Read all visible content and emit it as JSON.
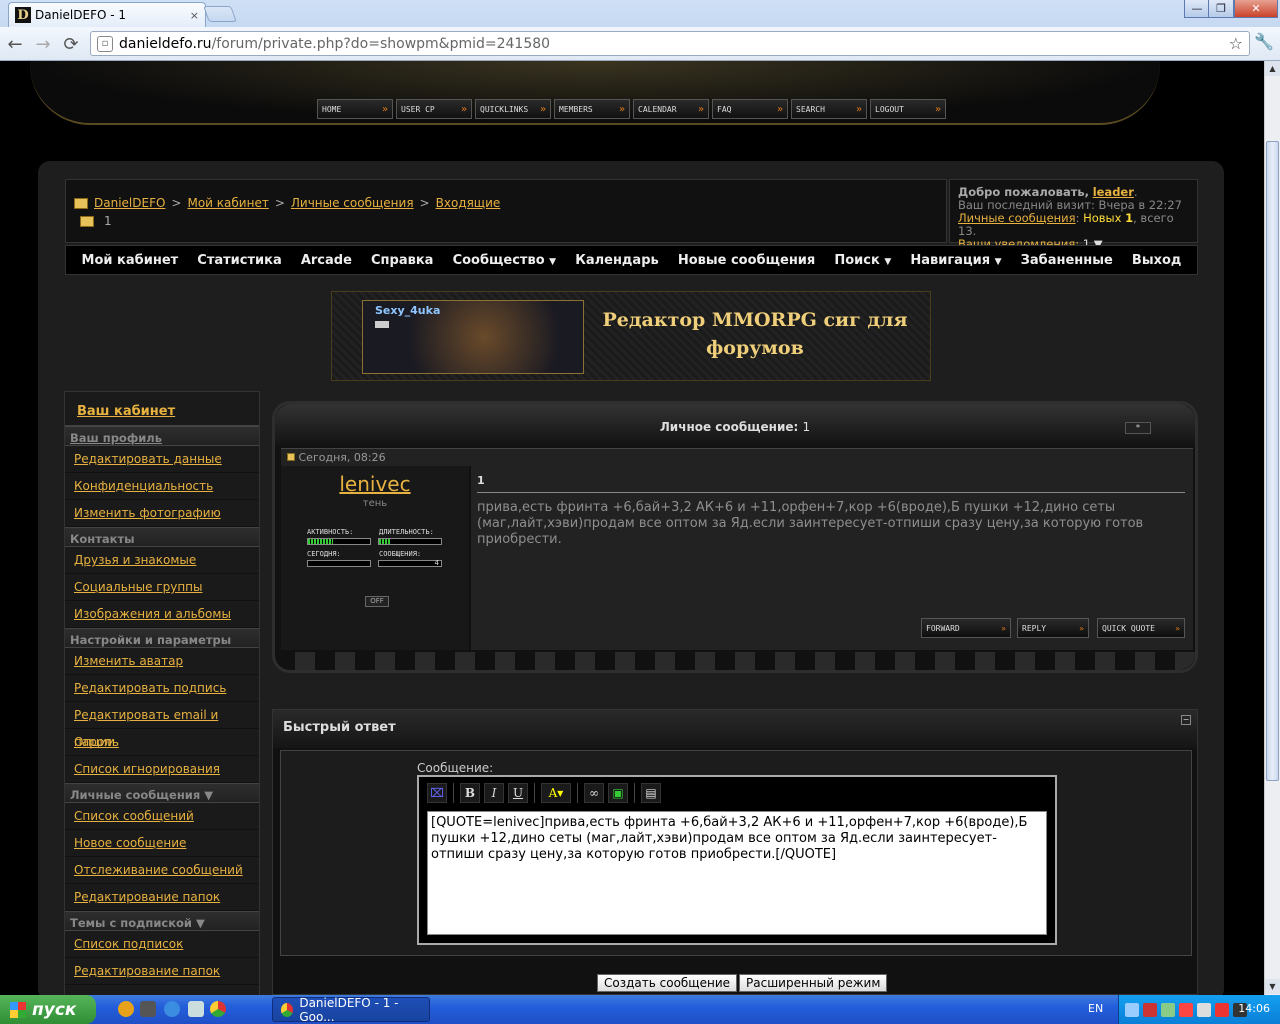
{
  "browser": {
    "tab_title": "DanielDEFO - 1",
    "tab_close": "×",
    "url_host": "danieldefo.ru",
    "url_path": "/forum/private.php?do=showpm&pmid=241580",
    "win_min": "—",
    "win_max": "❐",
    "win_close": "✕"
  },
  "topnav": [
    {
      "label": "HOME"
    },
    {
      "label": "USER CP"
    },
    {
      "label": "QUICKLINKS"
    },
    {
      "label": "MEMBERS"
    },
    {
      "label": "CALENDAR"
    },
    {
      "label": "FAQ"
    },
    {
      "label": "SEARCH"
    },
    {
      "label": "LOGOUT"
    }
  ],
  "breadcrumb": {
    "items": [
      "DanielDEFO",
      "Мой кабинет",
      "Личные сообщения",
      "Входящие"
    ],
    "sep": ">",
    "current": "1"
  },
  "welcome": {
    "greeting": "Добро пожаловать,",
    "username": "leader",
    "last_visit": "Ваш последний визит: Вчера в 22:27",
    "pm_link": "Личные сообщения",
    "pm_new_label": "Новых",
    "pm_new": "1",
    "pm_total": ", всего 13.",
    "notif_link": "Ваши уведомления:",
    "notif_count": "1"
  },
  "menu": {
    "items": [
      "Мой кабинет",
      "Статистика",
      "Arcade",
      "Справка",
      "Сообщество",
      "Календарь",
      "Новые сообщения",
      "Поиск",
      "Навигация",
      "Забаненные",
      "Выход"
    ],
    "dropdown_icon": "▼"
  },
  "banner": {
    "name": "Sexy_4uka",
    "title": "Редактор MMORPG сиг для форумов"
  },
  "sidebar": {
    "head": "Ваш кабинет",
    "sections": [
      {
        "title": "Ваш профиль",
        "items": [
          "Редактировать данные",
          "Конфиденциальность",
          "Изменить фотографию"
        ]
      },
      {
        "title": "Контакты",
        "items": [
          "Друзья и знакомые",
          "Социальные группы",
          "Изображения и альбомы"
        ]
      },
      {
        "title": "Настройки и параметры",
        "items": [
          "Изменить аватар",
          "Редактировать подпись",
          "Редактировать email и пароль",
          "Опции",
          "Список игнорирования"
        ]
      },
      {
        "title": "Личные сообщения ▼",
        "items": [
          "Список сообщений",
          "Новое сообщение",
          "Отслеживание сообщений",
          "Редактирование папок"
        ]
      },
      {
        "title": "Темы с подпиской ▼",
        "items": [
          "Список подписок",
          "Редактирование папок"
        ]
      }
    ]
  },
  "pm": {
    "header_label": "Личное сообщение:",
    "header_value": "1",
    "collapse": "*",
    "date": "Сегодня, 08:26",
    "user": "lenivec",
    "user_title": "тень",
    "activity": "АКТИВНОСТЬ:",
    "duration": "ДЛИТЕЛЬНОСТЬ:",
    "today": "СЕГОДНЯ:",
    "posts": "СООБЩЕНИЯ:",
    "posts_count": "4",
    "activity_level": 0.4,
    "duration_level": 0.18,
    "status": "OFF",
    "title": "1",
    "message": "прива,есть фринта +6,бай+3,2 АК+6 и +11,орфен+7,кор +6(вроде),Б пушки +12,дино сеты (маг,лайт,хэви)продам все оптом за Яд.если заинтересует-отпиши сразу цену,за которую готов приобрести.",
    "btn_forward": "FORWARD",
    "btn_reply": "REPLY",
    "btn_quote": "QUICK QUOTE"
  },
  "quickreply": {
    "title": "Быстрый ответ",
    "label": "Сообщение:",
    "text": "[QUOTE=lenivec]прива,есть фринта +6,бай+3,2 АК+6 и +11,орфен+7,кор +6(вроде),Б пушки +12,дино сеты (маг,лайт,хэви)продам все оптом за Яд.если заинтересует-отпиши сразу цену,за которую готов приобрести.[/QUOTE]",
    "submit": "Создать сообщение",
    "advanced": "Расширенный режим"
  },
  "taskbar": {
    "start": "пуск",
    "task": "DanielDEFO - 1 - Goo...",
    "lang": "EN",
    "clock": "14:06"
  }
}
